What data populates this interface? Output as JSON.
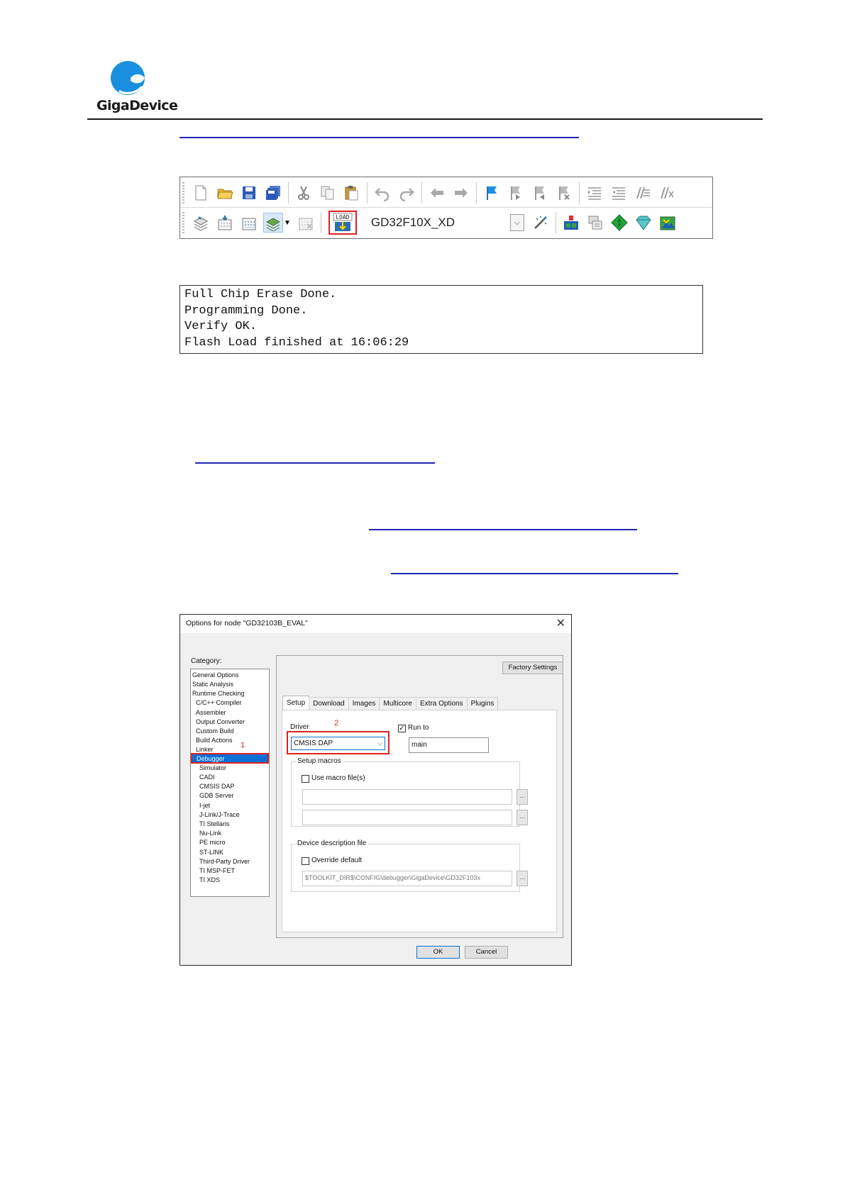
{
  "header": {
    "brand": "GigaDevice",
    "accent_color": "#1a8fe0"
  },
  "toolbar": {
    "target_name": "GD32F10X_XD",
    "load_label": "LOAD",
    "row1_icons": [
      "new-file-icon",
      "open-folder-icon",
      "save-icon",
      "save-all-icon",
      "cut-icon",
      "copy-icon",
      "paste-icon",
      "undo-icon",
      "redo-icon",
      "navigate-back-icon",
      "navigate-forward-icon",
      "bookmark-icon",
      "bookmark-next-icon",
      "bookmark-prev-icon",
      "bookmark-clear-icon",
      "indent-icon",
      "unindent-icon",
      "comment-icon",
      "uncomment-icon"
    ],
    "row2_icons": [
      "compile-icon",
      "make-icon",
      "rebuild-icon",
      "batch-build-icon",
      "stop-build-icon",
      "download-load-icon",
      "target-combo",
      "options-icon",
      "debug-icon",
      "debug-without-download-icon",
      "go-icon",
      "break-icon",
      "reset-icon"
    ]
  },
  "console": {
    "lines": [
      "Full Chip Erase Done.",
      "Programming Done.",
      "Verify OK.",
      "Flash Load finished at 16:06:29"
    ]
  },
  "dialog": {
    "title": "Options for node \"GD32103B_EVAL\"",
    "close": "✕",
    "category_label": "Category:",
    "categories": [
      "General Options",
      "Static Analysis",
      "Runtime Checking",
      "C/C++ Compiler",
      "Assembler",
      "Output Converter",
      "Custom Build",
      "Build Actions",
      "Linker",
      "Debugger",
      "Simulator",
      "CADI",
      "CMSIS DAP",
      "GDB Server",
      "I-jet",
      "J-Link/J-Trace",
      "TI Stellaris",
      "Nu-Link",
      "PE micro",
      "ST-LINK",
      "Third-Party Driver",
      "TI MSP-FET",
      "TI XDS"
    ],
    "selected_category": "Debugger",
    "marker_1": "1",
    "marker_2": "2",
    "factory_settings": "Factory Settings",
    "tabs": [
      "Setup",
      "Download",
      "Images",
      "Multicore",
      "Extra Options",
      "Plugins"
    ],
    "driver_label": "Driver",
    "driver_value": "CMSIS DAP",
    "run_to_label": "Run to",
    "run_to_checked": true,
    "run_to_value": "main",
    "setup_macros_label": "Setup macros",
    "use_macro_label": "Use macro file(s)",
    "device_desc_label": "Device description file",
    "override_default_label": "Override default",
    "device_desc_path": "$TOOLKIT_DIR$\\CONFIG\\debugger\\GigaDevice\\GD32F103x",
    "browse": "...",
    "ok": "OK",
    "cancel": "Cancel"
  }
}
